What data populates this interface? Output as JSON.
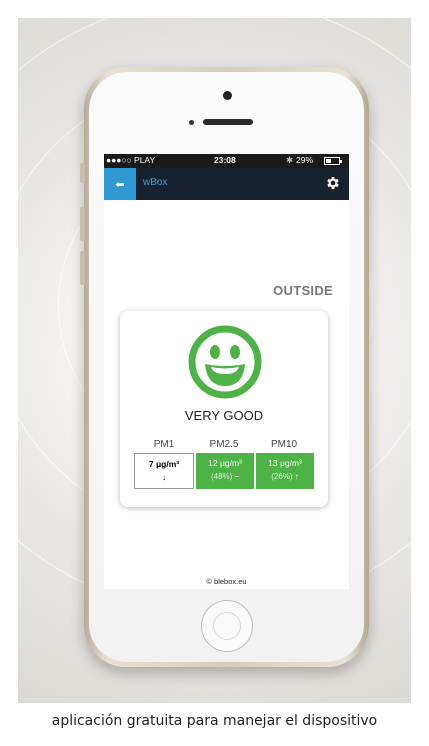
{
  "status": {
    "carrier": "●●●○○ PLAY",
    "time": "23:08",
    "bluetooth": "✱",
    "battery": "29%"
  },
  "appbar": {
    "back_glyph": "⬅",
    "title": "wBox",
    "settings_icon": "gear-icon"
  },
  "main": {
    "location": "OUTSIDE",
    "quality": "VERY GOOD",
    "face": "smiley-icon",
    "columns": [
      {
        "label": "PM1",
        "value": "7 μg/m³",
        "percent": "",
        "trend": "↓",
        "style": "white"
      },
      {
        "label": "PM2.5",
        "value": "12 μg/m³",
        "percent": "(48%)",
        "trend": "–",
        "style": "green"
      },
      {
        "label": "PM10",
        "value": "13 μg/m³",
        "percent": "(26%)",
        "trend": "↑",
        "style": "green"
      }
    ],
    "footer": "© blebox.eu"
  },
  "caption": "aplicación gratuita para manejar el dispositivo",
  "colors": {
    "accent": "#2f9ad2",
    "good": "#4db346",
    "appbar": "#17222e"
  }
}
